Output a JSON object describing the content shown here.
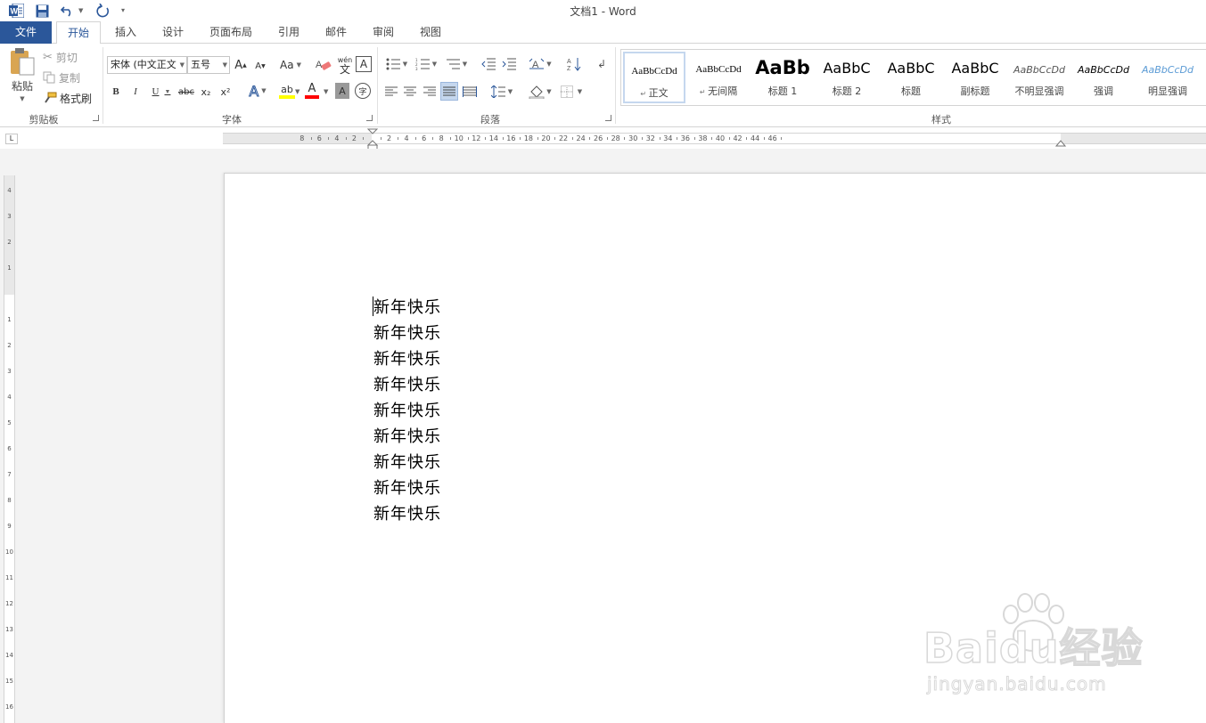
{
  "window": {
    "title": "文档1 - Word"
  },
  "quick_access": {
    "icons": [
      "word-app-icon",
      "save-icon",
      "undo-icon",
      "redo-icon",
      "customize-icon"
    ]
  },
  "tabs": [
    {
      "label": "文件"
    },
    {
      "label": "开始"
    },
    {
      "label": "插入"
    },
    {
      "label": "设计"
    },
    {
      "label": "页面布局"
    },
    {
      "label": "引用"
    },
    {
      "label": "邮件"
    },
    {
      "label": "审阅"
    },
    {
      "label": "视图"
    }
  ],
  "active_tab": "开始",
  "clipboard": {
    "group_label": "剪贴板",
    "paste_label": "粘贴",
    "cut_label": "剪切",
    "copy_label": "复制",
    "format_painter_label": "格式刷"
  },
  "font": {
    "group_label": "字体",
    "font_name": "宋体 (中文正文",
    "font_size": "五号",
    "grow_label": "A",
    "shrink_label": "A",
    "case_label": "Aa",
    "phonetic_label": "wén",
    "bold": "B",
    "italic": "I",
    "underline": "U",
    "strike": "abc",
    "subscript": "x₂",
    "superscript": "x²",
    "effects": "A",
    "font_color": "A",
    "char_shading": "A",
    "enclose": "字",
    "border_char": "A"
  },
  "paragraph": {
    "group_label": "段落"
  },
  "styles": {
    "group_label": "样式",
    "items": [
      {
        "preview": "AaBbCcDd",
        "name": "正文"
      },
      {
        "preview": "AaBbCcDd",
        "name": "无间隔"
      },
      {
        "preview": "AaBb",
        "name": "标题 1"
      },
      {
        "preview": "AaBbC",
        "name": "标题 2"
      },
      {
        "preview": "AaBbC",
        "name": "标题"
      },
      {
        "preview": "AaBbC",
        "name": "副标题"
      },
      {
        "preview": "AaBbCcDd",
        "name": "不明显强调"
      },
      {
        "preview": "AaBbCcDd",
        "name": "强调"
      },
      {
        "preview": "AaBbCcDd",
        "name": "明显强调"
      }
    ]
  },
  "ruler": {
    "tab_selector": "L",
    "h_ticks": [
      "8",
      "6",
      "4",
      "2",
      "2",
      "4",
      "6",
      "8",
      "10",
      "12",
      "14",
      "16",
      "18",
      "20",
      "22",
      "24",
      "26",
      "28",
      "30",
      "32",
      "34",
      "36",
      "38",
      "40",
      "42",
      "44",
      "46"
    ],
    "v_ticks_top": [
      "4",
      "3",
      "2",
      "1"
    ],
    "v_ticks": [
      "1",
      "2",
      "3",
      "4",
      "5",
      "6",
      "7",
      "8",
      "9",
      "10",
      "11",
      "12",
      "13",
      "14",
      "15",
      "16"
    ]
  },
  "document": {
    "lines": [
      "新年快乐",
      "新年快乐",
      "新年快乐",
      "新年快乐",
      "新年快乐",
      "新年快乐",
      "新年快乐",
      "新年快乐",
      "新年快乐"
    ]
  },
  "watermark": {
    "text": "Baidu经验",
    "url": "jingyan.baidu.com"
  },
  "colors": {
    "file_tab": "#2b579a",
    "accent": "#2b579a",
    "highlight": "#ffff00",
    "font_color": "#ff0000"
  }
}
